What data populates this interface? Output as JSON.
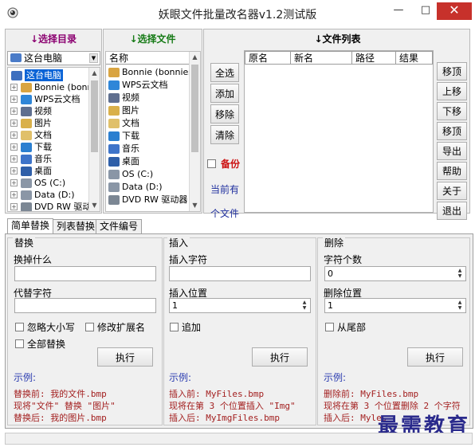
{
  "window": {
    "title": "妖眼文件批量改名器v1.2测试版",
    "minimize": "—",
    "maximize": "□",
    "close": "✕"
  },
  "dir_panel": {
    "header": "↓选择目录",
    "header_color": "#8b0070",
    "combo_value": "这台电脑",
    "items": [
      {
        "label": "这台电脑",
        "icon": "computer-icon",
        "selected": true
      },
      {
        "label": "Bonnie (bonni",
        "icon": "user-folder-icon"
      },
      {
        "label": "WPS云文档",
        "icon": "cloud-icon"
      },
      {
        "label": "视频",
        "icon": "video-folder-icon"
      },
      {
        "label": "图片",
        "icon": "picture-folder-icon"
      },
      {
        "label": "文档",
        "icon": "document-folder-icon"
      },
      {
        "label": "下载",
        "icon": "download-folder-icon"
      },
      {
        "label": "音乐",
        "icon": "music-folder-icon"
      },
      {
        "label": "桌面",
        "icon": "desktop-folder-icon"
      },
      {
        "label": "OS (C:)",
        "icon": "drive-icon"
      },
      {
        "label": "Data (D:)",
        "icon": "drive-icon"
      },
      {
        "label": "DVD RW 驱动",
        "icon": "dvd-icon"
      }
    ]
  },
  "file_panel": {
    "header": "↓选择文件",
    "header_color": "#157a15",
    "column": "名称",
    "items": [
      {
        "label": "Bonnie (bonniess)",
        "icon": "user-folder-icon"
      },
      {
        "label": "WPS云文档",
        "icon": "cloud-icon"
      },
      {
        "label": "视频",
        "icon": "video-folder-icon"
      },
      {
        "label": "图片",
        "icon": "picture-folder-icon"
      },
      {
        "label": "文档",
        "icon": "document-folder-icon"
      },
      {
        "label": "下载",
        "icon": "download-folder-icon"
      },
      {
        "label": "音乐",
        "icon": "music-folder-icon"
      },
      {
        "label": "桌面",
        "icon": "desktop-folder-icon"
      },
      {
        "label": "OS (C:)",
        "icon": "drive-icon"
      },
      {
        "label": "Data (D:)",
        "icon": "drive-icon"
      },
      {
        "label": "DVD RW 驱动器 (E",
        "icon": "dvd-icon"
      }
    ]
  },
  "list_panel": {
    "header": "↓文件列表",
    "columns": [
      "原名",
      "新名",
      "路径",
      "结果"
    ],
    "actions": [
      "全选",
      "添加",
      "移除",
      "清除"
    ],
    "backup_label": "备份",
    "current_has": "当前有",
    "file_count": "个文件",
    "side_buttons": [
      "移顶",
      "上移",
      "下移",
      "移顶",
      "导出",
      "帮助",
      "关于",
      "退出"
    ]
  },
  "tabs": [
    "简单替换",
    "列表替换",
    "文件编号"
  ],
  "replace_group": {
    "title": "替换",
    "find_label": "换掉什么",
    "find_value": "",
    "replace_label": "代替字符",
    "replace_value": "",
    "ignore_case": "忽略大小写",
    "change_ext": "修改扩展名",
    "replace_all": "全部替换",
    "run": "执行",
    "example_title": "示例:",
    "example": [
      "替换前: 我的文件.bmp",
      "现将\"文件\" 替换 \"图片\"",
      "替换后: 我的图片.bmp"
    ]
  },
  "insert_group": {
    "title": "插入",
    "chars_label": "插入字符",
    "chars_value": "",
    "pos_label": "插入位置",
    "pos_value": "1",
    "append": "追加",
    "run": "执行",
    "example_title": "示例:",
    "example": [
      "插入前: MyFiles.bmp",
      "现将在第 3 个位置插入 \"Img\"",
      "插入后: MyImgFiles.bmp"
    ]
  },
  "delete_group": {
    "title": "删除",
    "count_label": "字符个数",
    "count_value": "0",
    "pos_label": "删除位置",
    "pos_value": "1",
    "from_end": "从尾部",
    "run": "执行",
    "example_title": "示例:",
    "example": [
      "删除前: MyFiles.bmp",
      "现将在第 3 个位置删除 2 个字符",
      "插入后: Myles"
    ]
  },
  "watermark": "最需教育"
}
